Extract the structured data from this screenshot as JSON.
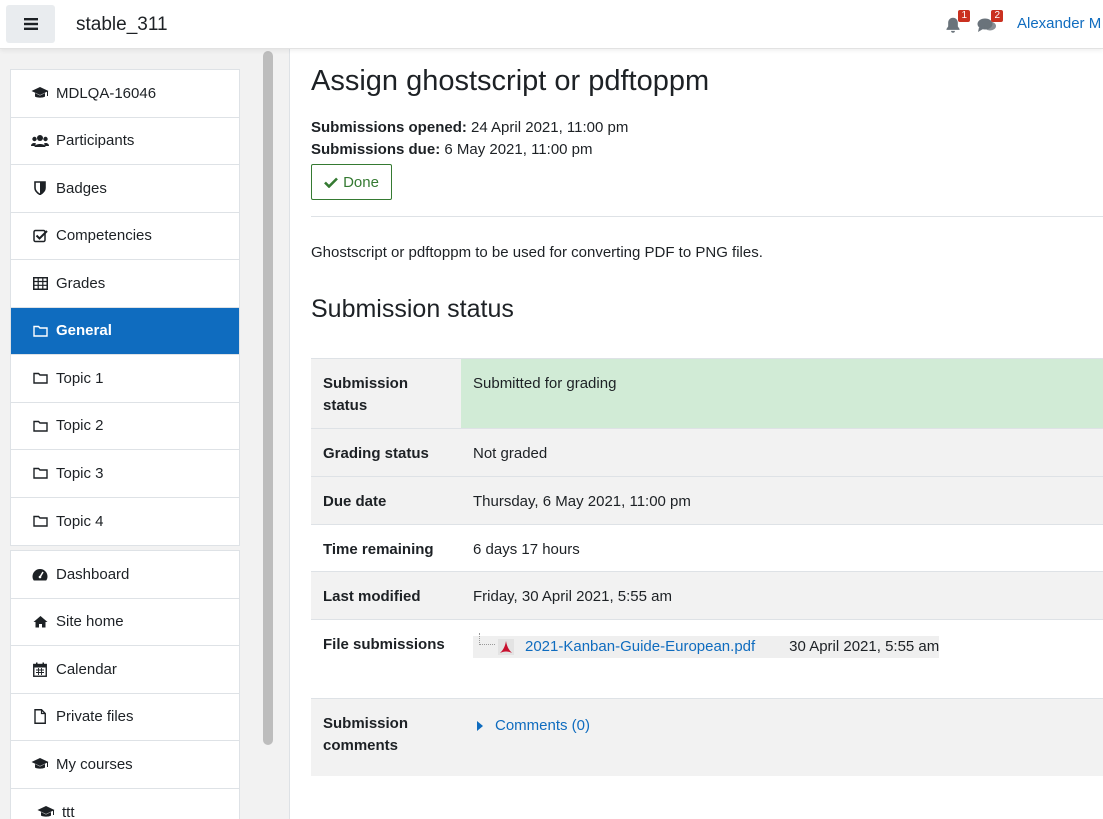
{
  "navbar": {
    "site_name": "stable_311",
    "notifications_count": "1",
    "messages_count": "2",
    "user_name": "Alexander M"
  },
  "drawer": {
    "course_items": [
      {
        "label": "MDLQA-16046",
        "icon": "graduation-cap-icon"
      },
      {
        "label": "Participants",
        "icon": "users-icon"
      },
      {
        "label": "Badges",
        "icon": "shield-icon"
      },
      {
        "label": "Competencies",
        "icon": "check-square-icon"
      },
      {
        "label": "Grades",
        "icon": "table-icon"
      },
      {
        "label": "General",
        "icon": "folder-icon",
        "active": true
      },
      {
        "label": "Topic 1",
        "icon": "folder-icon"
      },
      {
        "label": "Topic 2",
        "icon": "folder-icon"
      },
      {
        "label": "Topic 3",
        "icon": "folder-icon"
      },
      {
        "label": "Topic 4",
        "icon": "folder-icon"
      }
    ],
    "site_items": [
      {
        "label": "Dashboard",
        "icon": "dashboard-icon"
      },
      {
        "label": "Site home",
        "icon": "home-icon"
      },
      {
        "label": "Calendar",
        "icon": "calendar-icon"
      },
      {
        "label": "Private files",
        "icon": "file-icon"
      },
      {
        "label": "My courses",
        "icon": "graduation-cap-icon"
      },
      {
        "label": "ttt",
        "icon": "graduation-cap-icon"
      }
    ]
  },
  "main": {
    "title": "Assign ghostscript or pdftoppm",
    "opened_label": "Submissions opened:",
    "opened_value": "24 April 2021, 11:00 pm",
    "due_label": "Submissions due:",
    "due_value": "6 May 2021, 11:00 pm",
    "done_label": "Done",
    "intro": "Ghostscript or pdftoppm to be used for converting PDF to PNG files.",
    "section_title": "Submission status"
  },
  "status": {
    "submission_status_label": "Submission status",
    "submission_status_value": "Submitted for grading",
    "grading_status_label": "Grading status",
    "grading_status_value": "Not graded",
    "due_date_label": "Due date",
    "due_date_value": "Thursday, 6 May 2021, 11:00 pm",
    "time_remaining_label": "Time remaining",
    "time_remaining_value": "6 days 17 hours",
    "last_modified_label": "Last modified",
    "last_modified_value": "Friday, 30 April 2021, 5:55 am",
    "file_submissions_label": "File submissions",
    "file_name": "2021-Kanban-Guide-European.pdf",
    "file_date": "30 April 2021, 5:55 am",
    "comments_label": "Submission comments",
    "comments_link": "Comments (0)"
  },
  "colors": {
    "primary": "#0f6cbf",
    "success": "#357a32",
    "submitted_bg": "#d1ebd6",
    "badge": "#ca3120"
  }
}
